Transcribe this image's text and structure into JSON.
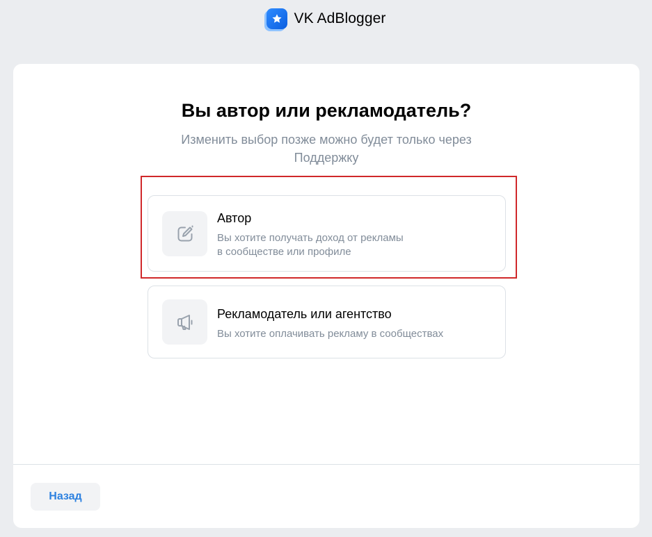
{
  "header": {
    "app_name": "VK AdBlogger",
    "logo_icon": "star-icon",
    "accent": "#0a5ee0"
  },
  "main": {
    "title": "Вы автор или рекламодатель?",
    "subtitle": "Изменить выбор позже можно будет только через Поддержку",
    "options": [
      {
        "title": "Автор",
        "description": [
          "Вы хотите получать доход от рекламы",
          "в сообществе или профиле"
        ],
        "icon": "edit-icon",
        "highlighted": true,
        "highlight_color": "#d0282a"
      },
      {
        "title": "Рекламодатель или агентство",
        "description": [
          "Вы хотите оплачивать рекламу в сообществах"
        ],
        "icon": "megaphone-icon",
        "highlighted": false
      }
    ]
  },
  "footer": {
    "back_label": "Назад",
    "back_color": "#2d81e0"
  }
}
